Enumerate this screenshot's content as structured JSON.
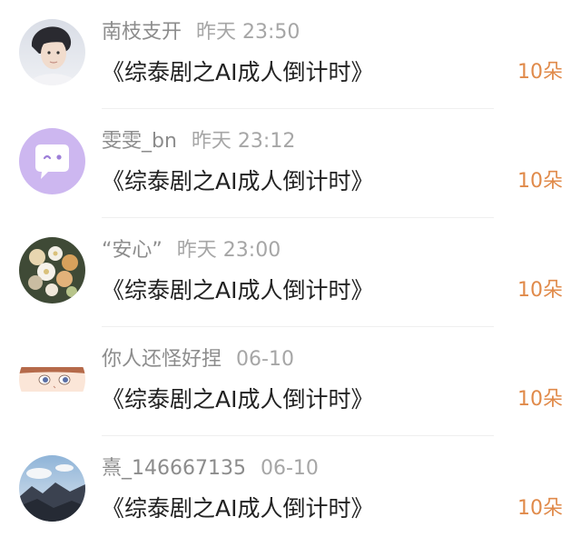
{
  "accent_color": "#e08a4a",
  "items": [
    {
      "name": "南枝支开",
      "time": "昨天 23:50",
      "title": "《综泰剧之AI成人倒计时》",
      "count": "10朵",
      "avatar_icon": "portrait-avatar-icon"
    },
    {
      "name": "雯雯_bn",
      "time": "昨天 23:12",
      "title": "《综泰剧之AI成人倒计时》",
      "count": "10朵",
      "avatar_icon": "chat-bubble-avatar-icon"
    },
    {
      "name": "“安心”",
      "time": "昨天 23:00",
      "title": "《综泰剧之AI成人倒计时》",
      "count": "10朵",
      "avatar_icon": "flowers-avatar-icon"
    },
    {
      "name": "你人还怪好捏",
      "time": "06-10",
      "title": "《综泰剧之AI成人倒计时》",
      "count": "10朵",
      "avatar_icon": "anime-face-avatar-icon"
    },
    {
      "name": "熹_146667135",
      "time": "06-10",
      "title": "《综泰剧之AI成人倒计时》",
      "count": "10朵",
      "avatar_icon": "landscape-avatar-icon"
    }
  ]
}
